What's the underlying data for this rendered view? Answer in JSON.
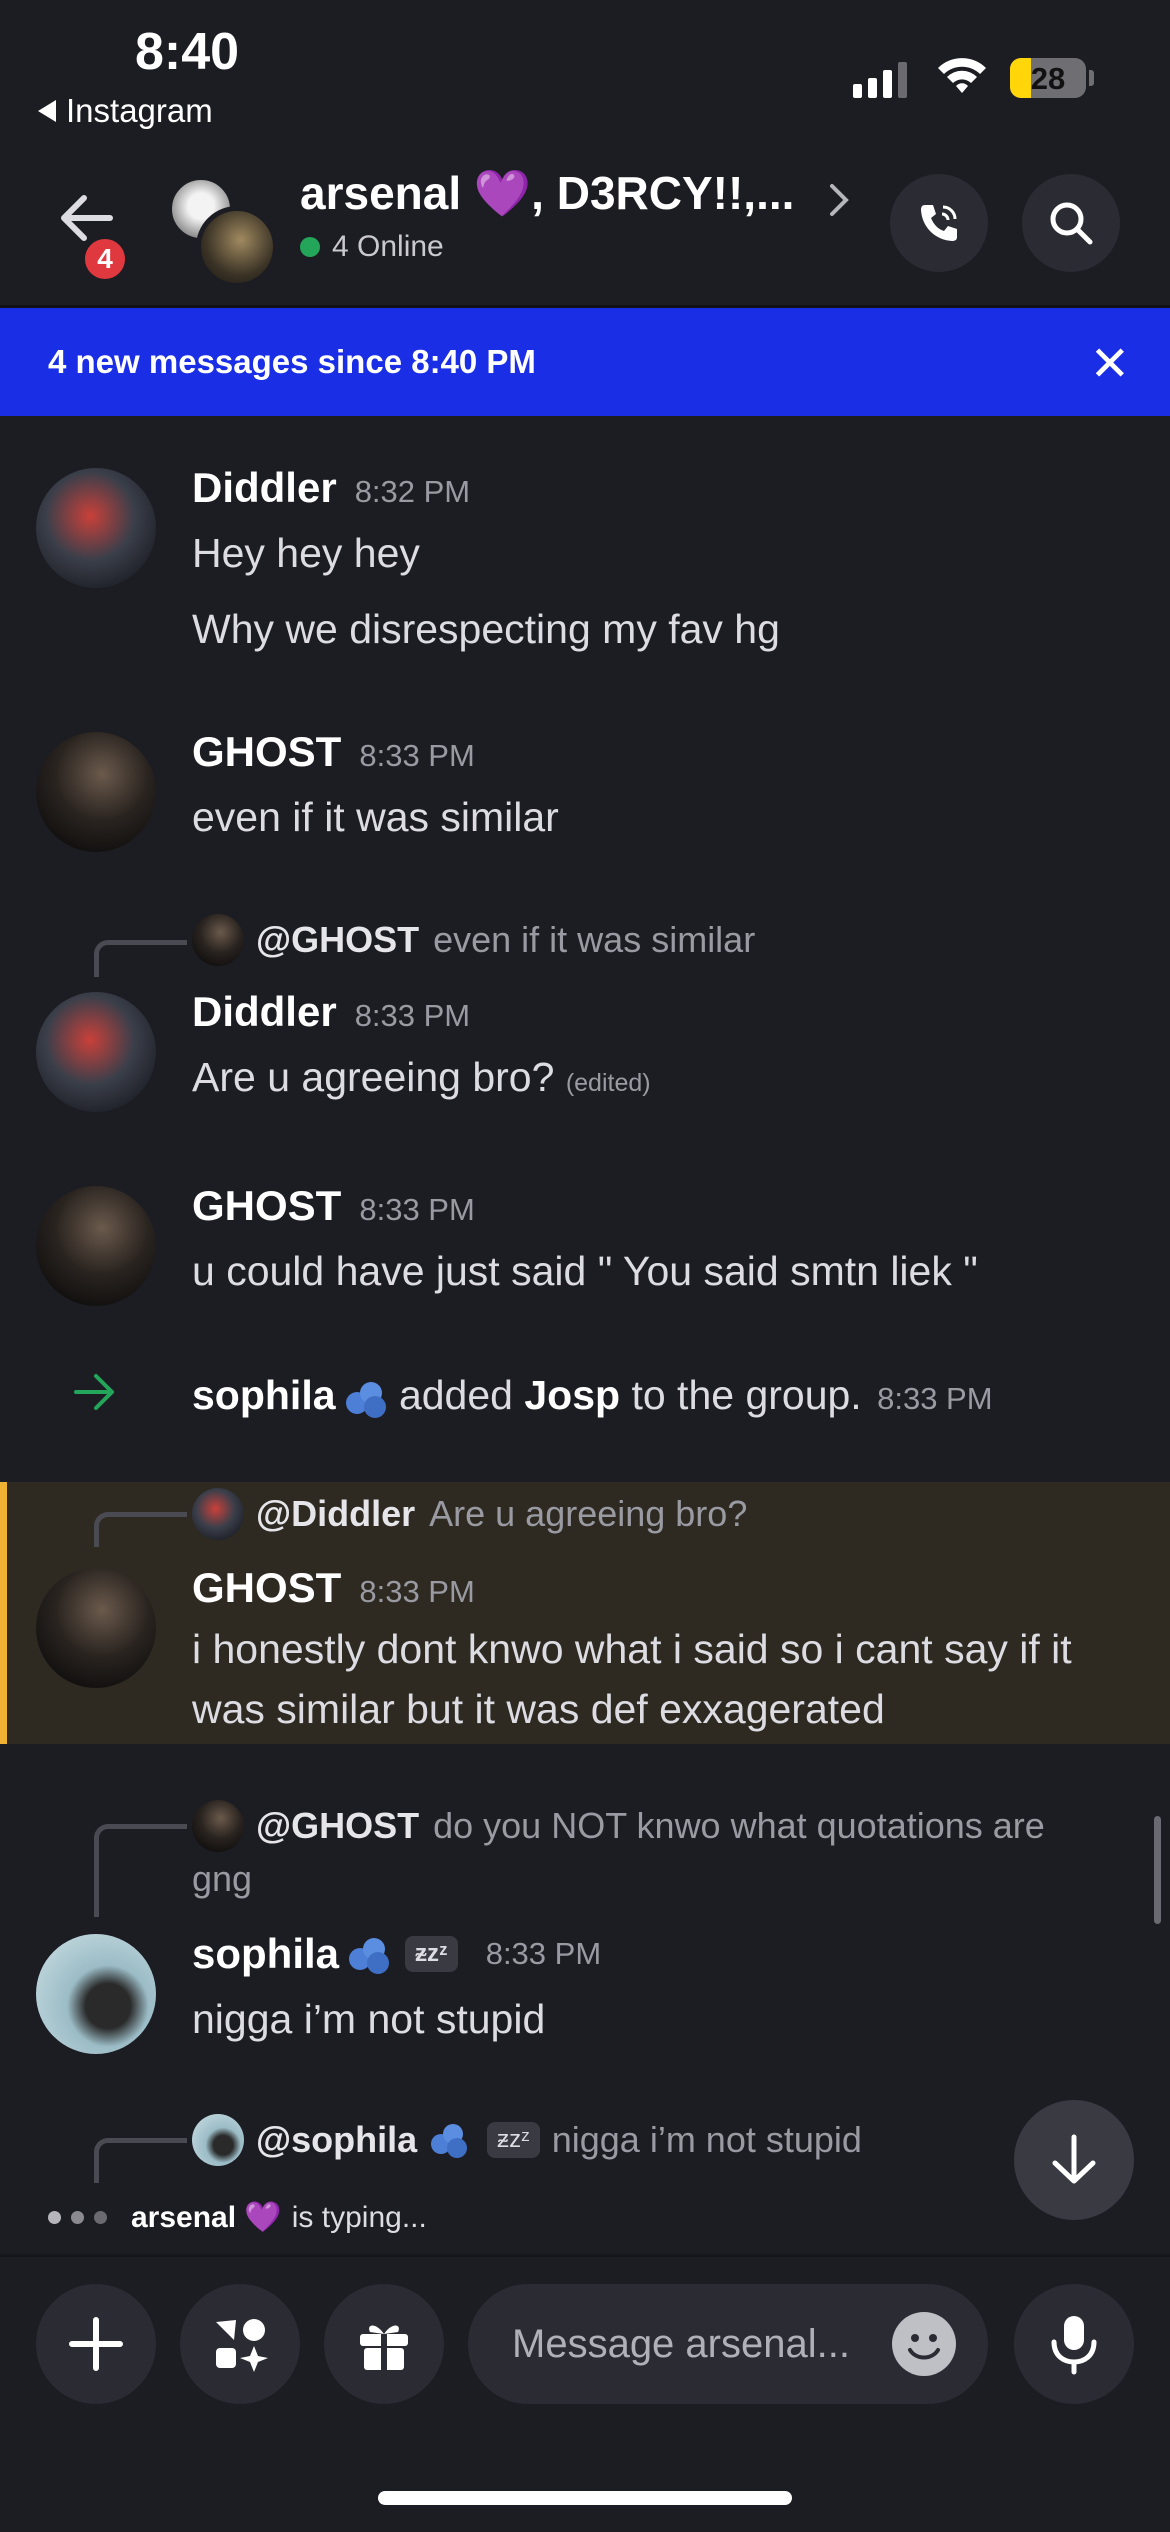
{
  "status_bar": {
    "time": "8:40",
    "back_app": "Instagram",
    "battery": "28",
    "battery_level": 0.28,
    "icons": [
      "signal-icon",
      "wifi-icon",
      "battery-charging-icon"
    ]
  },
  "header": {
    "back_badge": "4",
    "title": "arsenal 💜, D3RCY!!,...",
    "online": "4 Online",
    "icons": [
      "back-arrow-icon",
      "chevron-right-icon",
      "phone-call-icon",
      "search-icon"
    ]
  },
  "banner": {
    "text": "4 new messages since 8:40 PM",
    "close": "✕"
  },
  "messages": {
    "m1": {
      "author": "Diddler",
      "time": "8:32 PM",
      "line1": "Hey hey hey",
      "line2": "Why we disrespecting my fav hg"
    },
    "m2": {
      "author": "GHOST",
      "time": "8:33 PM",
      "text": "even if it was similar"
    },
    "m3": {
      "reply_to": "@GHOST",
      "reply_text": "even if it was similar",
      "author": "Diddler",
      "time": "8:33 PM",
      "text": "Are u agreeing bro?",
      "edited": "(edited)"
    },
    "m4": {
      "author": "GHOST",
      "time": "8:33 PM",
      "text": "u could have just said \" You said smtn liek \""
    },
    "system": {
      "actor": "sophila",
      "middle": "added",
      "target": "Josp",
      "suffix": "to the group.",
      "time": "8:33 PM"
    },
    "m5": {
      "reply_to": "@Diddler",
      "reply_text": "Are u agreeing bro?",
      "author": "GHOST",
      "time": "8:33 PM",
      "line1": "i honestly dont knwo what i said so i cant say if it",
      "line2": "was similar but it was def exxagerated"
    },
    "m6": {
      "reply_to": "@GHOST",
      "reply_text_1": "do you NOT knwo what quotations are",
      "reply_text_2": "gng",
      "author": "sophila",
      "tag": "ᵶzᶻ",
      "time": "8:33 PM",
      "text": "nigga i’m not stupid"
    },
    "m7": {
      "reply_to": "@sophila",
      "tag": "ᵶzᶻ",
      "reply_text": "nigga i’m not stupid"
    }
  },
  "typing": {
    "user": "arsenal 💜",
    "text": "is typing..."
  },
  "composer": {
    "placeholder": "Message arsenal...",
    "icons": [
      "plus-icon",
      "apps-icon",
      "gift-icon",
      "emoji-icon",
      "microphone-icon",
      "arrow-down-icon"
    ]
  }
}
